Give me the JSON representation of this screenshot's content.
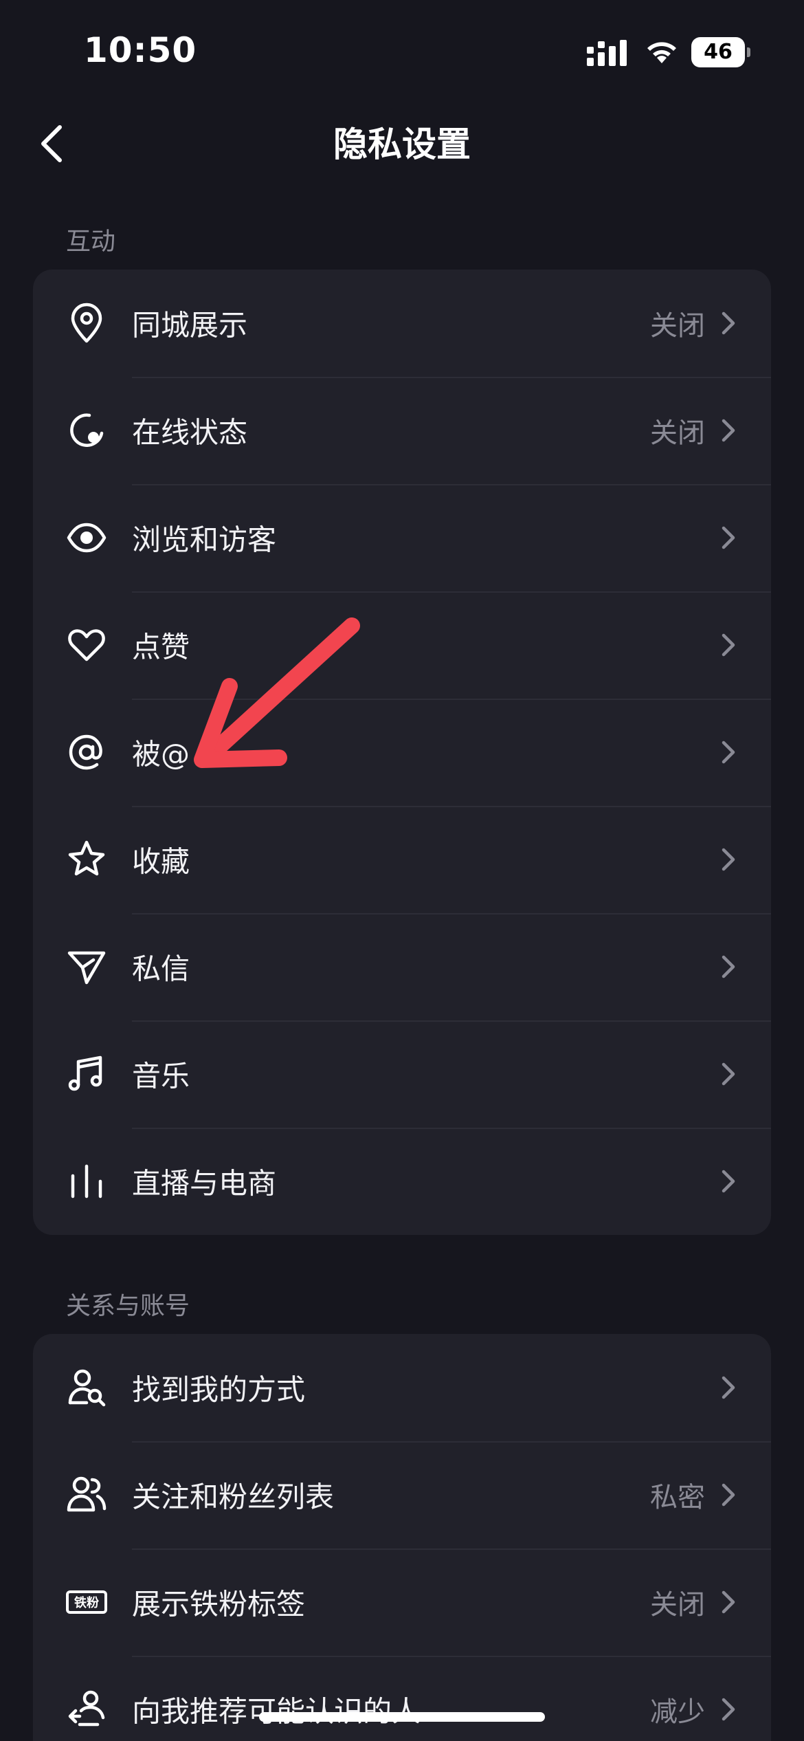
{
  "status_bar": {
    "time": "10:50",
    "battery": "46"
  },
  "header": {
    "title": "隐私设置"
  },
  "sections": [
    {
      "label": "互动",
      "items": [
        {
          "icon": "location-pin-icon",
          "label": "同城展示",
          "value": "关闭"
        },
        {
          "icon": "online-status-icon",
          "label": "在线状态",
          "value": "关闭"
        },
        {
          "icon": "eye-icon",
          "label": "浏览和访客",
          "value": ""
        },
        {
          "icon": "heart-icon",
          "label": "点赞",
          "value": ""
        },
        {
          "icon": "at-sign-icon",
          "label": "被@",
          "value": ""
        },
        {
          "icon": "star-icon",
          "label": "收藏",
          "value": ""
        },
        {
          "icon": "send-icon",
          "label": "私信",
          "value": ""
        },
        {
          "icon": "music-note-icon",
          "label": "音乐",
          "value": ""
        },
        {
          "icon": "live-bars-icon",
          "label": "直播与电商",
          "value": ""
        }
      ]
    },
    {
      "label": "关系与账号",
      "items": [
        {
          "icon": "find-user-icon",
          "label": "找到我的方式",
          "value": ""
        },
        {
          "icon": "users-icon",
          "label": "关注和粉丝列表",
          "value": "私密"
        },
        {
          "icon": "iron-fan-badge-icon",
          "label": "展示铁粉标签",
          "value": "关闭",
          "badge_text": "铁粉"
        },
        {
          "icon": "recommend-user-icon",
          "label": "向我推荐可能认识的人",
          "value": "减少"
        }
      ]
    }
  ],
  "colors": {
    "background": "#16161e",
    "card": "#21212a",
    "secondary_text": "#8a8a95",
    "annotation_arrow": "#f2454f"
  }
}
